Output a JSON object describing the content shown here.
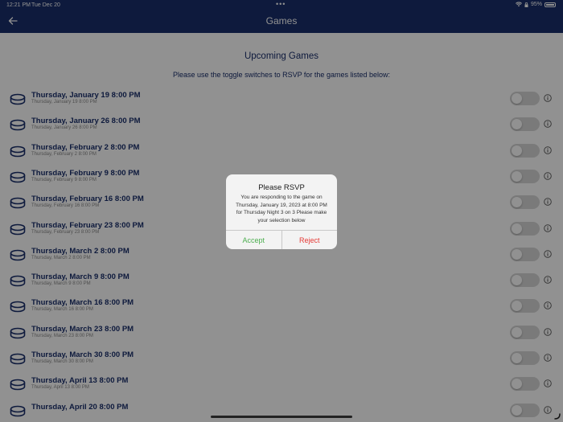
{
  "status_bar": {
    "time": "12:21 PM",
    "date": "Tue Dec 20",
    "battery": "95%"
  },
  "nav": {
    "title": "Games"
  },
  "main": {
    "heading": "Upcoming Games",
    "subheading": "Please use the toggle switches to RSVP for the games listed below:",
    "games": [
      {
        "title": "Thursday, January 19 8:00 PM",
        "subtitle": "Thursday, January 19 8:00 PM"
      },
      {
        "title": "Thursday, January 26 8:00 PM",
        "subtitle": "Thursday, January 26 8:00 PM"
      },
      {
        "title": "Thursday, February 2 8:00 PM",
        "subtitle": "Thursday, February 2 8:00 PM"
      },
      {
        "title": "Thursday, February 9 8:00 PM",
        "subtitle": "Thursday, February 9 8:00 PM"
      },
      {
        "title": "Thursday, February 16 8:00 PM",
        "subtitle": "Thursday, February 16 8:00 PM"
      },
      {
        "title": "Thursday, February 23 8:00 PM",
        "subtitle": "Thursday, February 23 8:00 PM"
      },
      {
        "title": "Thursday, March 2 8:00 PM",
        "subtitle": "Thursday, March 2 8:00 PM"
      },
      {
        "title": "Thursday, March 9 8:00 PM",
        "subtitle": "Thursday, March 9 8:00 PM"
      },
      {
        "title": "Thursday, March 16 8:00 PM",
        "subtitle": "Thursday, March 16 8:00 PM"
      },
      {
        "title": "Thursday, March 23 8:00 PM",
        "subtitle": "Thursday, March 23 8:00 PM"
      },
      {
        "title": "Thursday, March 30 8:00 PM",
        "subtitle": "Thursday, March 30 8:00 PM"
      },
      {
        "title": "Thursday, April 13 8:00 PM",
        "subtitle": "Thursday, April 13 8:00 PM"
      },
      {
        "title": "Thursday, April 20 8:00 PM",
        "subtitle": ""
      }
    ]
  },
  "dialog": {
    "title": "Please RSVP",
    "message": "You are responding to the game on Thursday, January 19, 2023 at 8:00 PM for Thursday Night 3 on 3 Please make your selection below",
    "accept_label": "Accept",
    "reject_label": "Reject"
  },
  "icons": {
    "back": "arrow-left-icon",
    "game": "hockey-puck-icon",
    "info": "info-icon",
    "wifi": "wifi-icon",
    "battery": "battery-icon"
  },
  "colors": {
    "nav": "#1a2f6b",
    "text_primary": "#1a2f6b",
    "accept": "#4cae4f",
    "reject": "#e53935"
  }
}
